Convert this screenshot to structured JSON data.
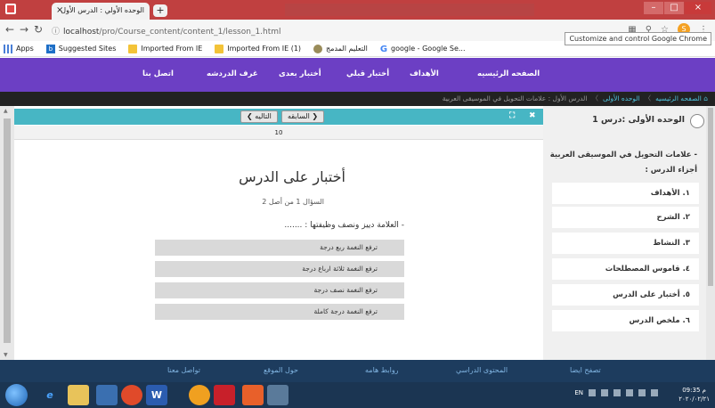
{
  "browser": {
    "tab_title": "الوحده الأولي : الدرس الأول",
    "tab_close": "×",
    "new_tab": "+",
    "url_host": "localhost",
    "url_path": "/pro/Course_content/content_1/lesson_1.html",
    "profile_initial": "S",
    "tooltip": "Customize and control Google Chrome",
    "window_controls": [
      "–",
      "□",
      "×"
    ]
  },
  "bookmarks": [
    {
      "label": "Apps",
      "icon": "apps-icon"
    },
    {
      "label": "Suggested Sites",
      "icon": "bing-icon"
    },
    {
      "label": "Imported From IE",
      "icon": "folder-icon"
    },
    {
      "label": "Imported From IE (1)",
      "icon": "folder-icon"
    },
    {
      "label": "التعليم المدمج",
      "icon": "globe-icon"
    },
    {
      "label": "google - Google Se...",
      "icon": "google-icon"
    }
  ],
  "site_nav": {
    "home": "الصفحه الرئيسيه",
    "objectives": "الأهداف",
    "pre_test": "أختبار قبلي",
    "post_test": "أختبار بعدى",
    "chat_rooms": "غرف الدردشه",
    "contact": "اتصل بنا"
  },
  "breadcrumb": {
    "home": "الصفحه الرئيسيه",
    "unit": "الوحده الأولى",
    "lesson": "الدرس الأول : علامات التحويل في الموسيقى العربية",
    "separator": "〉"
  },
  "toolbar": {
    "next": "التاليه ❯",
    "prev": "❮ السابقه",
    "expand_icon": "⛶",
    "close_icon": "✖",
    "page_indicator": "10"
  },
  "quiz": {
    "title": "أختبار على الدرس",
    "counter": "السؤال 1 من أصل 2",
    "question": "- العلامة دييز ونصف وظيفتها : .......",
    "options": [
      "ترفع النغمة ربع درجة",
      "ترفع النغمة ثلاثة ارباع درجة",
      "ترفع النغمة نصف درجة",
      "ترفع النغمة درجة كاملة"
    ]
  },
  "sidebar": {
    "unit_title": "الوحده الأولى :درس 1",
    "lesson_subtitle": "- علامات التحويل في الموسيقى العربية",
    "parts_heading": "أجزاء الدرس :",
    "items": [
      "١. الأهداف",
      "٢. الشرح",
      "٣. النشاط",
      "٤. قاموس المصطلحات",
      "٥. أختبار على الدرس",
      "٦. ملخص الدرس"
    ]
  },
  "footer": {
    "browse_also": "تصفح ايضا",
    "curriculum": "المحتوى الدراسي",
    "links": "روابط هامه",
    "about": "حول الموقع",
    "contact": "تواصل معنا"
  },
  "taskbar": {
    "lang": "EN",
    "time": "09:35 م",
    "date": "٢٠٢٠/٠٢/٢١"
  }
}
